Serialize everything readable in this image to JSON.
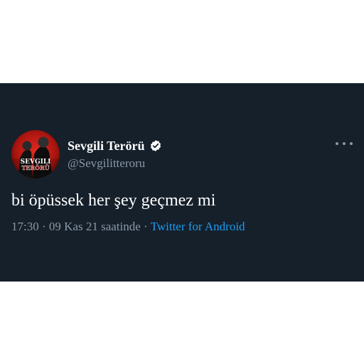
{
  "tweet": {
    "display_name": "Sevgili Terörü",
    "handle": "@Sevgilitteroru",
    "text": "bi öpüssek her şey geçmez mi",
    "time": "17:30",
    "separator": "·",
    "date": "09 Kas 21 saatinde",
    "source": "Twitter for Android",
    "verified": true,
    "avatar_text_top": "SEVGILI",
    "avatar_text_bottom": "TERÖRÜ"
  },
  "icons": {
    "verified": "verified-badge-icon",
    "more": "more-options-icon"
  },
  "colors": {
    "background": "#15202b",
    "primary_text": "#ffffff",
    "secondary_text": "#8b98a5",
    "link": "#1d9bf0",
    "avatar_accent": "#e0201f"
  }
}
